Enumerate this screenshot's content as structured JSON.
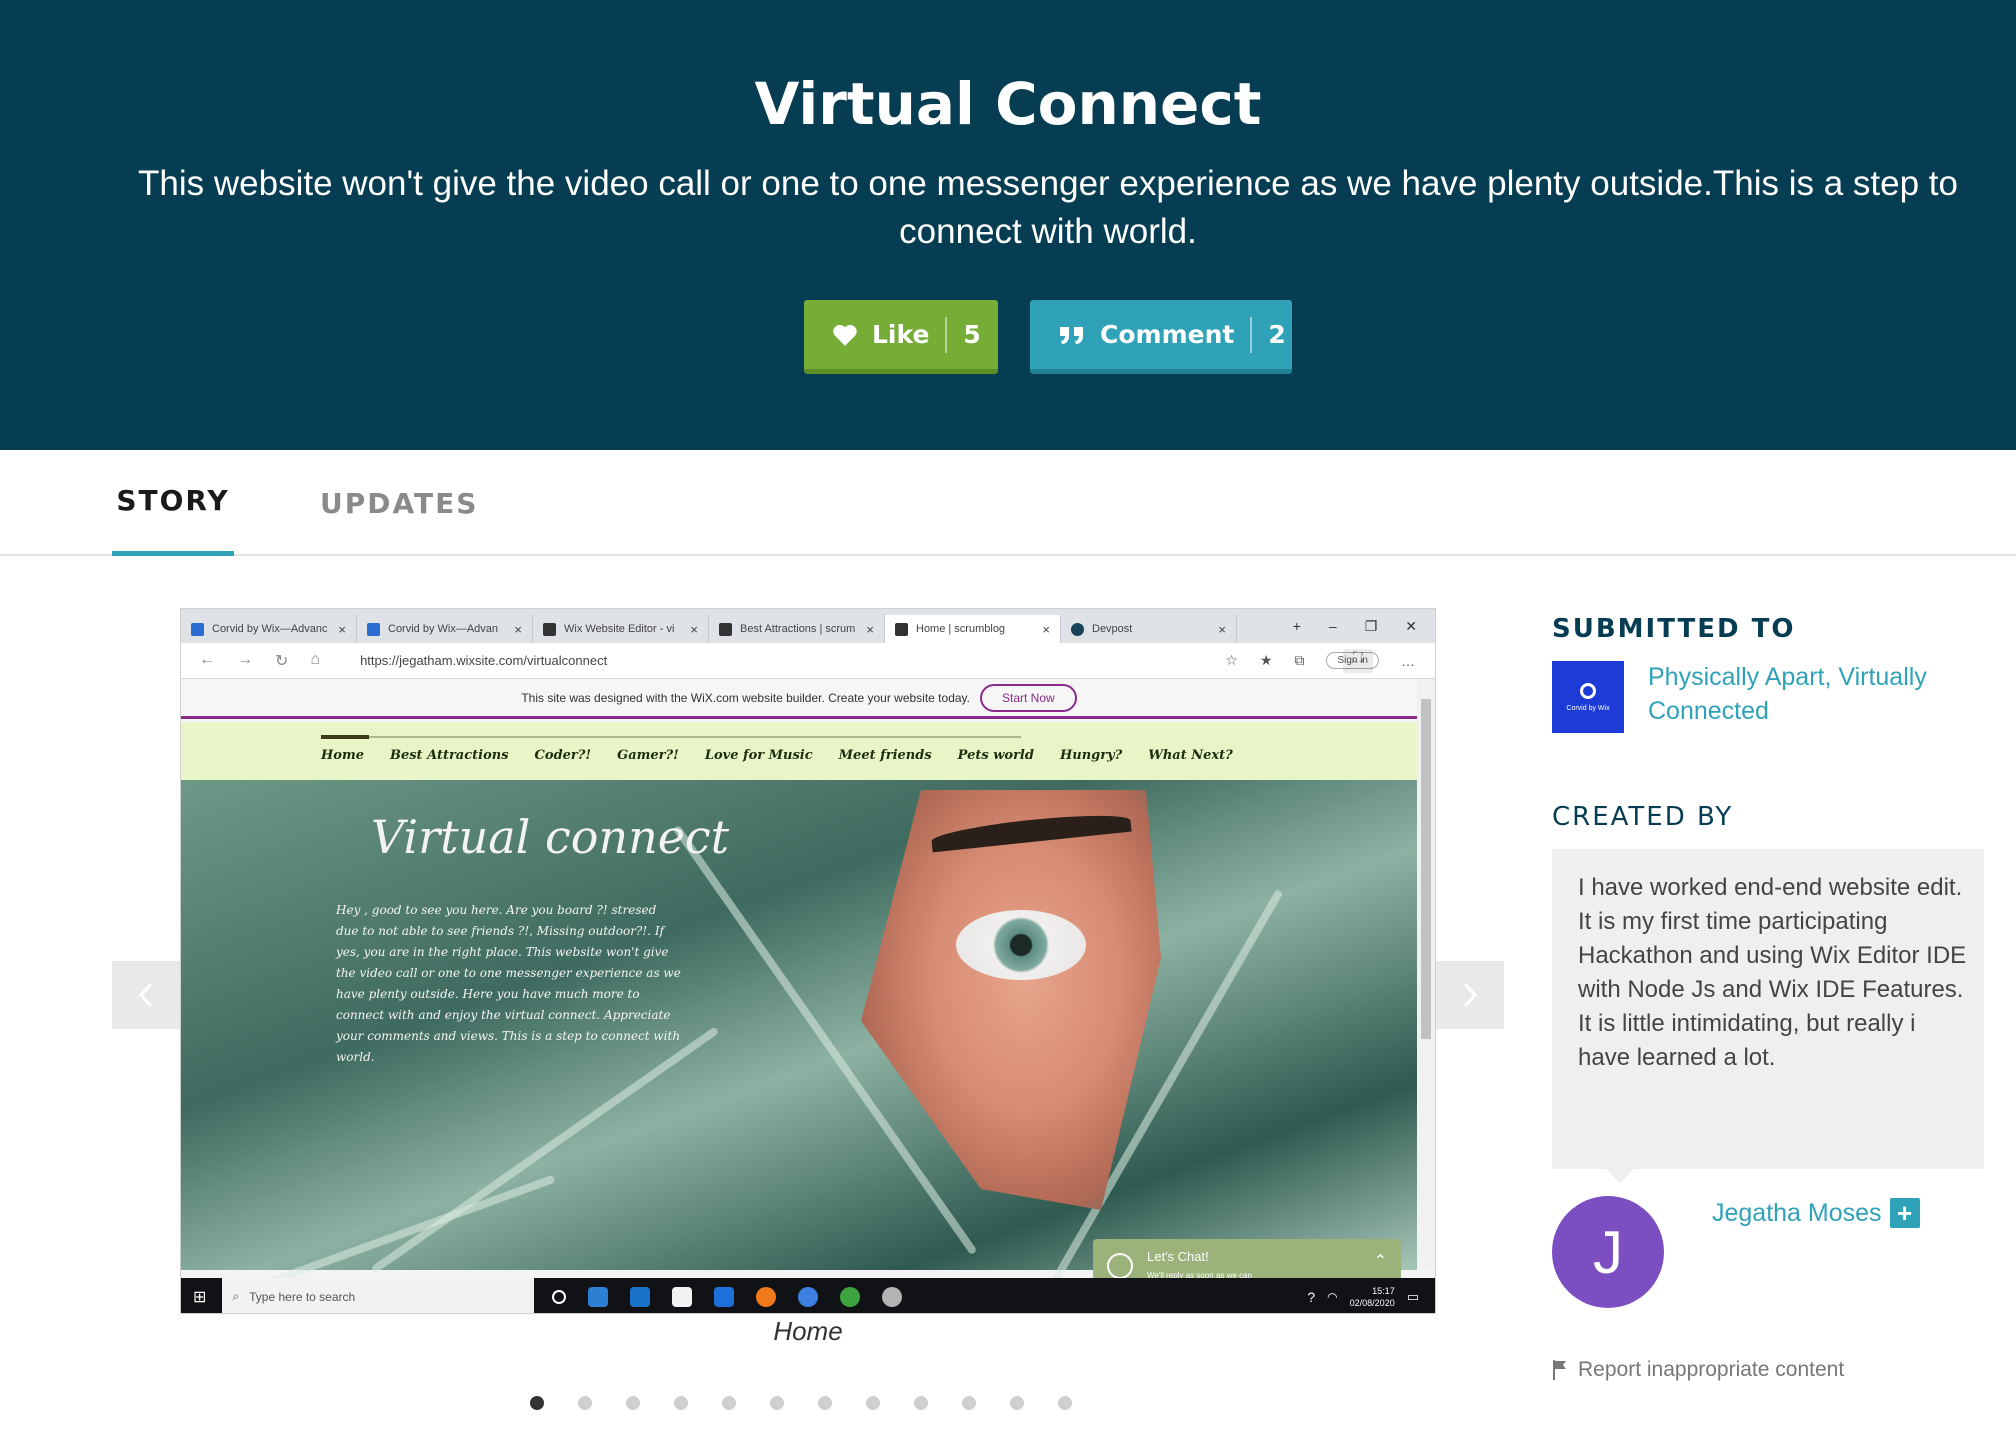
{
  "header": {
    "title": "Virtual Connect",
    "tagline": "This website won't give the video call or one to one messenger experience as we have plenty outside.This is a step to connect with world.",
    "like_label": "Like",
    "like_count": "5",
    "comment_label": "Comment",
    "comment_count": "2",
    "colors": {
      "background": "#063d52",
      "like": "#76ad37",
      "comment": "#2fa2b8"
    }
  },
  "tabs": [
    {
      "label": "STORY",
      "active": true
    },
    {
      "label": "UPDATES",
      "active": false
    }
  ],
  "gallery": {
    "caption": "Home",
    "slide_count": 12,
    "active_index": 0,
    "screenshot": {
      "browser_tabs": [
        "Corvid by Wix—Advanc",
        "Corvid by Wix—Advan",
        "Wix Website Editor - vi",
        "Best Attractions | scrum",
        "Home | scrumblog",
        "Devpost"
      ],
      "url": "https://jegatham.wixsite.com/virtualconnect",
      "sign_in": "Sign in",
      "wix_banner": "This site was designed with the WiX.com website builder. Create your website today.",
      "wix_button": "Start Now",
      "site_nav": [
        "Home",
        "Best Attractions",
        "Coder?!",
        "Gamer?!",
        "Love for Music",
        "Meet friends",
        "Pets world",
        "Hungry?",
        "What Next?"
      ],
      "site_title": "Virtual connect",
      "site_text": "Hey , good to see you here. Are you board ?! stresed due to not able to see friends ?!, Missing outdoor?!. If yes, you are in the right place. This website won't give the video call or one to one messenger experience as we have plenty outside. Here you have much more to connect with and enjoy the virtual connect. Appreciate your comments and views. This is a step to connect with world.",
      "chat_title": "Let's Chat!",
      "chat_sub": "We'll reply as soon as we can",
      "taskbar_search": "Type here to search",
      "clock_time": "15:17",
      "clock_date": "02/08/2020"
    }
  },
  "sidebar": {
    "submitted_heading": "SUBMITTED TO",
    "hackathon_name": "Physically Apart, Virtually Connected",
    "hackathon_logo_text": "Corvid by Wix",
    "created_heading": "CREATED BY",
    "bio": "I have worked end-end website edit. It is my first time participating Hackathon and using Wix Editor IDE with Node Js and Wix IDE Features. It is little intimidating, but really i have learned a lot.",
    "avatar_initial": "J",
    "creator_name": "Jegatha Moses",
    "report_label": "Report inappropriate content"
  }
}
